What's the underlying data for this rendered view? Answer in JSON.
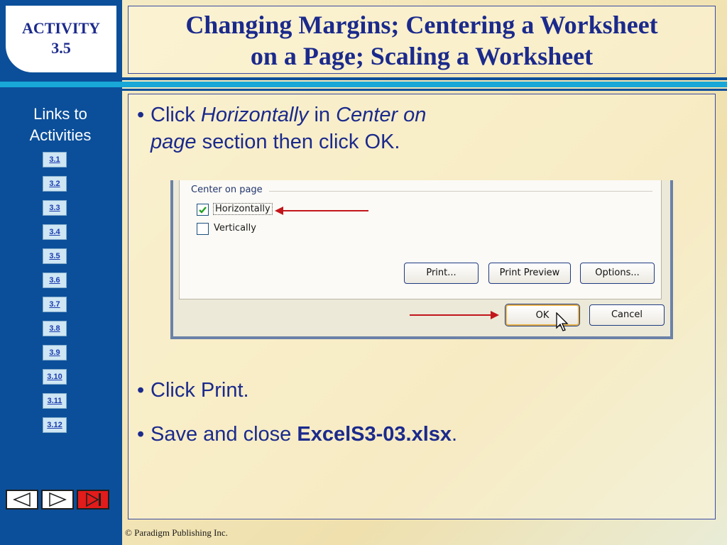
{
  "activity": {
    "label": "ACTIVITY",
    "number": "3.5"
  },
  "title": {
    "line1": "Changing Margins; Centering a Worksheet",
    "line2": "on a Page; Scaling a Worksheet"
  },
  "sidebar": {
    "heading_line1": "Links to",
    "heading_line2": "Activities",
    "links": [
      "3.1",
      "3.2",
      "3.3",
      "3.4",
      "3.5",
      "3.6",
      "3.7",
      "3.8",
      "3.9",
      "3.10",
      "3.11",
      "3.12"
    ]
  },
  "nav": {
    "prev": "previous-slide",
    "next": "next-slide",
    "end": "end-show"
  },
  "bullets": {
    "b1": {
      "part1": "Click ",
      "part2": "Horizontally",
      "part3": " in ",
      "part4": "Center on",
      "part5": "page",
      "part6": " section then click OK."
    },
    "b2": {
      "text": "Click Print."
    },
    "b3": {
      "part1": "Save and close ",
      "part2": "ExcelS3-03.xlsx",
      "part3": "."
    }
  },
  "dialog": {
    "group_label": "Center on page",
    "horizontally": {
      "label": "Horizontally",
      "checked": true
    },
    "vertically": {
      "label": "Vertically",
      "checked": false
    },
    "buttons": {
      "print": "Print...",
      "print_preview": "Print Preview",
      "options": "Options...",
      "ok": "OK",
      "cancel": "Cancel"
    }
  },
  "footer": {
    "text": "© Paradigm Publishing Inc."
  },
  "colors": {
    "dark_blue": "#0b4f9a",
    "cyan": "#18a7d6",
    "title_text": "#1b2a8c",
    "arrow_red": "#c2161b"
  }
}
